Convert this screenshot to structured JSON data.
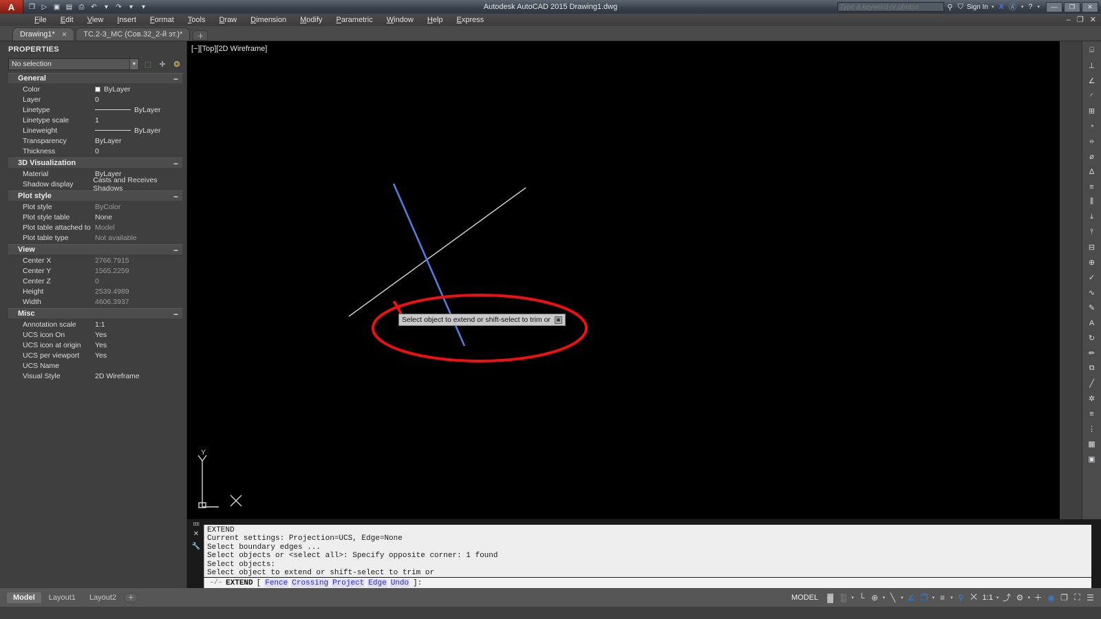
{
  "titlebar": {
    "logo": "A",
    "title": "Autodesk AutoCAD 2015    Drawing1.dwg",
    "quick_access": [
      {
        "name": "new-file-icon",
        "glyph": "❐"
      },
      {
        "name": "open-file-icon",
        "glyph": "▷"
      },
      {
        "name": "save-icon",
        "glyph": "▣"
      },
      {
        "name": "save-as-icon",
        "glyph": "▤"
      },
      {
        "name": "plot-icon",
        "glyph": "⎙"
      },
      {
        "name": "undo-icon",
        "glyph": "↶"
      },
      {
        "name": "undo-dropdown-icon",
        "glyph": "▾"
      },
      {
        "name": "redo-icon",
        "glyph": "↷"
      },
      {
        "name": "redo-dropdown-icon",
        "glyph": "▾"
      },
      {
        "name": "qat-customize-icon",
        "glyph": "▾"
      }
    ],
    "search_placeholder": "Type a keyword or phrase",
    "search_value": "",
    "search_icon": "⚲",
    "signin_label": "Sign In",
    "signin_icon": "⛉",
    "exchange_icon": "X",
    "autodesk_icon": "Ⓐ",
    "help_icon": "?",
    "window_buttons": [
      {
        "name": "minimize-button",
        "glyph": "—"
      },
      {
        "name": "restore-button",
        "glyph": "❐"
      },
      {
        "name": "close-button",
        "glyph": "✕"
      }
    ],
    "doc_window_buttons": "– ❐ ✕"
  },
  "menubar": {
    "items": [
      {
        "name": "menu-file",
        "label": "File"
      },
      {
        "name": "menu-edit",
        "label": "Edit"
      },
      {
        "name": "menu-view",
        "label": "View"
      },
      {
        "name": "menu-insert",
        "label": "Insert"
      },
      {
        "name": "menu-format",
        "label": "Format"
      },
      {
        "name": "menu-tools",
        "label": "Tools"
      },
      {
        "name": "menu-draw",
        "label": "Draw"
      },
      {
        "name": "menu-dimension",
        "label": "Dimension"
      },
      {
        "name": "menu-modify",
        "label": "Modify"
      },
      {
        "name": "menu-parametric",
        "label": "Parametric"
      },
      {
        "name": "menu-window",
        "label": "Window"
      },
      {
        "name": "menu-help",
        "label": "Help"
      },
      {
        "name": "menu-express",
        "label": "Express"
      }
    ]
  },
  "file_tabs": {
    "tabs": [
      {
        "label": "Drawing1*",
        "active": true,
        "close": "✕"
      },
      {
        "label": "TC.2-3_MC (Сов.32_2-й эт.)*",
        "active": false,
        "close": ""
      }
    ],
    "add_label": "＋"
  },
  "properties": {
    "title": "PROPERTIES",
    "selection": "No selection",
    "toolbar_icons": [
      {
        "name": "quick-select-icon",
        "glyph": "⬚"
      },
      {
        "name": "select-objects-icon",
        "glyph": "✛"
      },
      {
        "name": "pick-point-icon",
        "glyph": "❂"
      }
    ],
    "groups": [
      {
        "name": "general",
        "label": "General",
        "collapse": "−",
        "rows": [
          {
            "key": "Color",
            "value": "ByLayer",
            "kind": "color",
            "dim": false
          },
          {
            "key": "Layer",
            "value": "0",
            "kind": "text",
            "dim": false
          },
          {
            "key": "Linetype",
            "value": "ByLayer",
            "kind": "line",
            "dim": false
          },
          {
            "key": "Linetype scale",
            "value": "1",
            "kind": "text",
            "dim": false
          },
          {
            "key": "Lineweight",
            "value": "ByLayer",
            "kind": "line",
            "dim": false
          },
          {
            "key": "Transparency",
            "value": "ByLayer",
            "kind": "text",
            "dim": false
          },
          {
            "key": "Thickness",
            "value": "0",
            "kind": "text",
            "dim": false
          }
        ]
      },
      {
        "name": "3d-visualization",
        "label": "3D Visualization",
        "collapse": "−",
        "rows": [
          {
            "key": "Material",
            "value": "ByLayer",
            "kind": "text",
            "dim": false
          },
          {
            "key": "Shadow display",
            "value": "Casts and Receives Shadows",
            "kind": "text",
            "dim": false
          }
        ]
      },
      {
        "name": "plot-style",
        "label": "Plot style",
        "collapse": "−",
        "rows": [
          {
            "key": "Plot style",
            "value": "ByColor",
            "kind": "text",
            "dim": true
          },
          {
            "key": "Plot style table",
            "value": "None",
            "kind": "text",
            "dim": false
          },
          {
            "key": "Plot table attached to",
            "value": "Model",
            "kind": "text",
            "dim": true
          },
          {
            "key": "Plot table type",
            "value": "Not available",
            "kind": "text",
            "dim": true
          }
        ]
      },
      {
        "name": "view",
        "label": "View",
        "collapse": "−",
        "rows": [
          {
            "key": "Center X",
            "value": "2766.7915",
            "kind": "text",
            "dim": true
          },
          {
            "key": "Center Y",
            "value": "1565.2259",
            "kind": "text",
            "dim": true
          },
          {
            "key": "Center Z",
            "value": "0",
            "kind": "text",
            "dim": true
          },
          {
            "key": "Height",
            "value": "2539.4989",
            "kind": "text",
            "dim": true
          },
          {
            "key": "Width",
            "value": "4606.3937",
            "kind": "text",
            "dim": true
          }
        ]
      },
      {
        "name": "misc",
        "label": "Misc",
        "collapse": "−",
        "rows": [
          {
            "key": "Annotation scale",
            "value": "1:1",
            "kind": "text",
            "dim": false
          },
          {
            "key": "UCS icon On",
            "value": "Yes",
            "kind": "text",
            "dim": false
          },
          {
            "key": "UCS icon at origin",
            "value": "Yes",
            "kind": "text",
            "dim": false
          },
          {
            "key": "UCS per viewport",
            "value": "Yes",
            "kind": "text",
            "dim": false
          },
          {
            "key": "UCS Name",
            "value": "",
            "kind": "text",
            "dim": false
          },
          {
            "key": "Visual Style",
            "value": "2D Wireframe",
            "kind": "text",
            "dim": false
          }
        ]
      }
    ]
  },
  "canvas": {
    "viewport_label": "[−][Top][2D Wireframe]",
    "background": "#000000",
    "tooltip_text": "Select object to extend or shift-select to trim or",
    "tooltip_expand_glyph": "▣",
    "ucs_y_label": "Y",
    "objects": [
      {
        "name": "blue-line",
        "color": "#4f7fe0"
      },
      {
        "name": "white-line",
        "color": "#d8d8d8"
      },
      {
        "name": "red-ellipse-annotation",
        "color": "#ef1111"
      }
    ]
  },
  "right_toolbar": {
    "icons": [
      {
        "name": "dimension-linear-icon",
        "glyph": "⌸"
      },
      {
        "name": "dimension-aligned-icon",
        "glyph": "⊥"
      },
      {
        "name": "dimension-angular-icon",
        "glyph": "∠"
      },
      {
        "name": "dimension-arc-icon",
        "glyph": "◜"
      },
      {
        "name": "dimension-ordinate-icon",
        "glyph": "⊞"
      },
      {
        "name": "dimension-radius-icon",
        "glyph": "◔"
      },
      {
        "name": "dimension-jogged-icon",
        "glyph": "⦵"
      },
      {
        "name": "dimension-diameter-icon",
        "glyph": "⌀"
      },
      {
        "name": "dimension-angle-icon",
        "glyph": "∆"
      },
      {
        "name": "dimension-baseline-icon",
        "glyph": "≡"
      },
      {
        "name": "dimension-continue-icon",
        "glyph": "⫼"
      },
      {
        "name": "dimension-space-icon",
        "glyph": "⤓"
      },
      {
        "name": "dimension-break-icon",
        "glyph": "⫯"
      },
      {
        "name": "tolerance-icon",
        "glyph": "⊟"
      },
      {
        "name": "center-mark-icon",
        "glyph": "⊕"
      },
      {
        "name": "inspect-icon",
        "glyph": "✓"
      },
      {
        "name": "jogged-linear-icon",
        "glyph": "∿"
      },
      {
        "name": "dimension-edit-icon",
        "glyph": "✎"
      },
      {
        "name": "dimension-text-edit-icon",
        "glyph": "A"
      },
      {
        "name": "dimension-update-icon",
        "glyph": "↻"
      },
      {
        "name": "dimension-style-icon",
        "glyph": "✏"
      },
      {
        "name": "reassociate-icon",
        "glyph": "⧉"
      },
      {
        "name": "dim-oblique-icon",
        "glyph": "╱"
      },
      {
        "name": "dim-override-icon",
        "glyph": "✲"
      },
      {
        "name": "dim-style-control-icon",
        "glyph": "≡"
      },
      {
        "name": "dim-more-icon",
        "glyph": "⋮"
      },
      {
        "name": "dim-extra-icon",
        "glyph": "▦"
      },
      {
        "name": "dim-last-icon",
        "glyph": "▣"
      }
    ]
  },
  "command_window": {
    "gutter_icons": [
      {
        "name": "command-grip-handle",
        "glyph": ""
      },
      {
        "name": "close-command-icon",
        "glyph": "✕"
      },
      {
        "name": "command-settings-icon",
        "glyph": "ὒ7"
      }
    ],
    "history": [
      "EXTEND",
      "Current settings: Projection=UCS, Edge=None",
      "Select boundary edges ...",
      "Select objects or <select all>: Specify opposite corner: 1 found",
      "Select objects:",
      "Select object to extend or shift-select to trim or"
    ],
    "input": {
      "prefix_glyph": "–/–",
      "command": "EXTEND",
      "bracket_open": "[",
      "options": [
        "Fence",
        "Crossing",
        "Project",
        "Edge",
        "Undo"
      ],
      "bracket_close": "]:"
    }
  },
  "layout_tabs": {
    "tabs": [
      {
        "label": "Model",
        "active": true
      },
      {
        "label": "Layout1",
        "active": false
      },
      {
        "label": "Layout2",
        "active": false
      }
    ],
    "add_label": "＋"
  },
  "statusbar": {
    "model_label": "MODEL",
    "annotation_scale": "1:1",
    "items": [
      {
        "name": "grid-display-toggle",
        "glyph": "▓",
        "on": false,
        "arrow": false
      },
      {
        "name": "snap-mode-toggle",
        "glyph": "░",
        "on": false,
        "arrow": true
      },
      {
        "name": "ortho-mode-toggle",
        "glyph": "└",
        "on": false,
        "arrow": false
      },
      {
        "name": "polar-tracking-toggle",
        "glyph": "⊕",
        "on": false,
        "arrow": true
      },
      {
        "name": "object-snap-toggle",
        "glyph": "╲",
        "on": false,
        "arrow": true
      },
      {
        "name": "object-snap-tracking-toggle",
        "glyph": "∠",
        "on": true,
        "arrow": false
      },
      {
        "name": "ucs-icon-toggle",
        "glyph": "❐",
        "on": true,
        "arrow": true
      },
      {
        "name": "lineweight-display-toggle",
        "glyph": "≡",
        "on": false,
        "arrow": true
      },
      {
        "name": "annotation-visibility-toggle",
        "glyph": "⚲",
        "on": true,
        "arrow": false
      },
      {
        "name": "autoscale-toggle",
        "glyph": "⨉",
        "on": false,
        "arrow": false
      },
      {
        "name": "annotation-scale-icon",
        "glyph": "⤴",
        "on": false,
        "arrow": false
      },
      {
        "name": "workspace-switching-icon",
        "glyph": "⚙",
        "on": false,
        "arrow": true
      },
      {
        "name": "hardware-acceleration-icon",
        "glyph": "＋",
        "on": false,
        "arrow": false
      },
      {
        "name": "isolate-objects-icon",
        "glyph": "◉",
        "on": true,
        "arrow": false
      },
      {
        "name": "clean-screen-icon",
        "glyph": "❐",
        "on": false,
        "arrow": false
      },
      {
        "name": "fullscreen-icon",
        "glyph": "⛶",
        "on": false,
        "arrow": false
      },
      {
        "name": "status-menu-icon",
        "glyph": "☰",
        "on": false,
        "arrow": false
      }
    ]
  }
}
